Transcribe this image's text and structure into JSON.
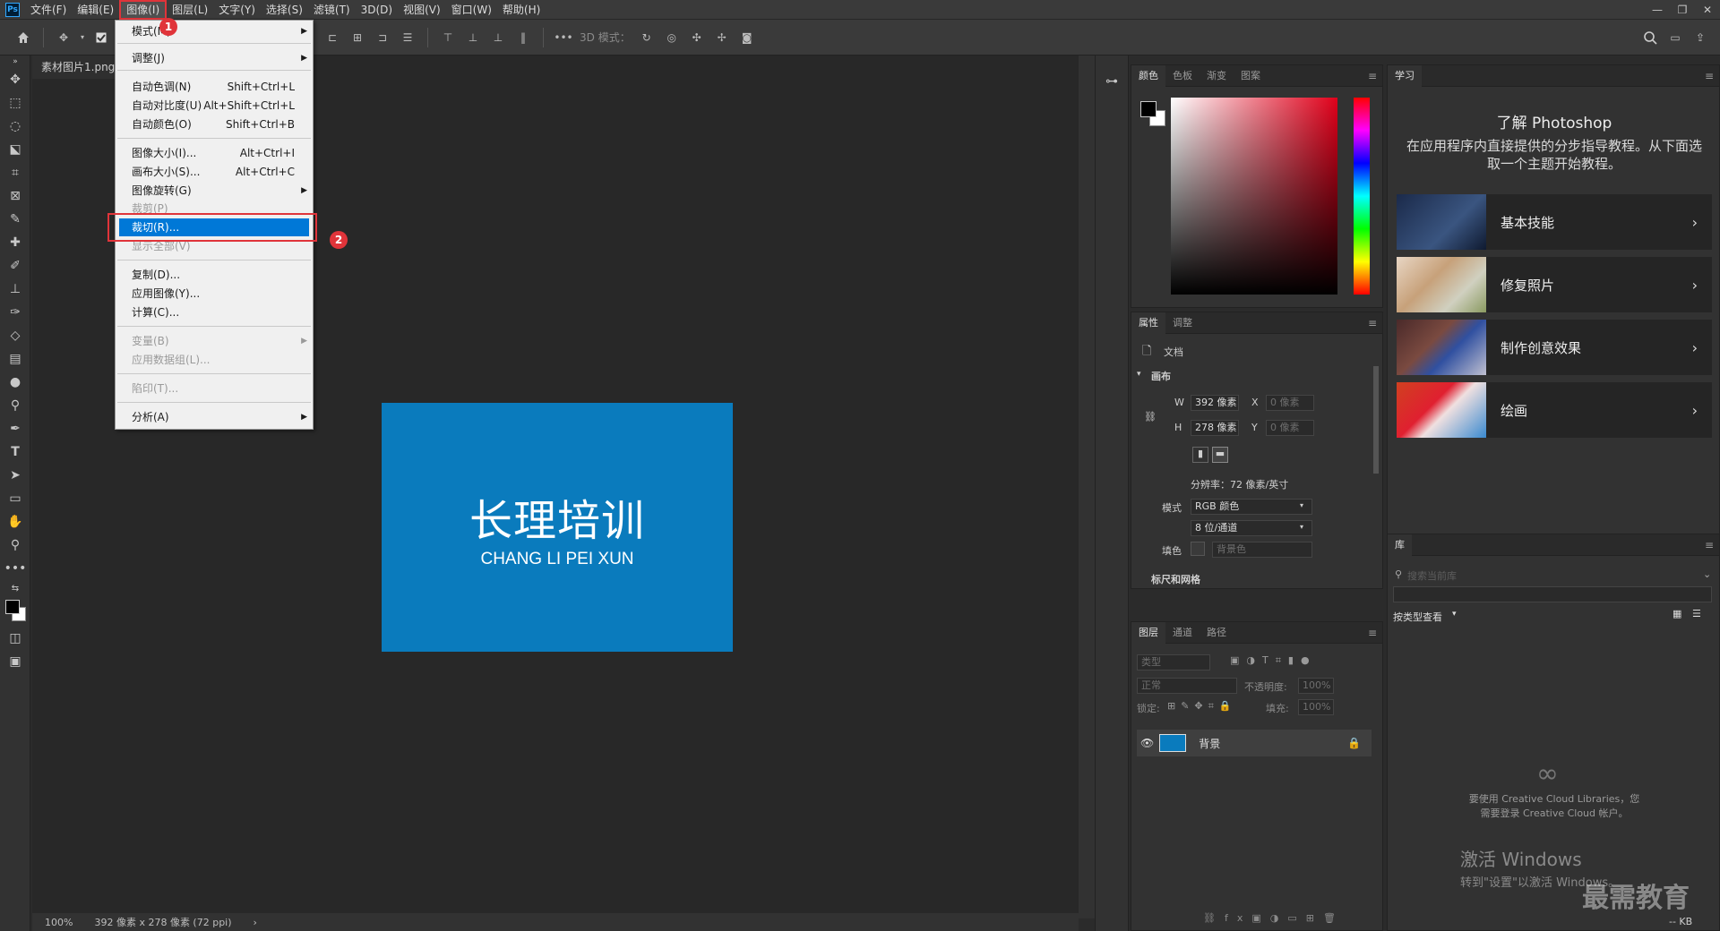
{
  "app": {
    "logo": "Ps"
  },
  "menubar": {
    "items": [
      "文件(F)",
      "编辑(E)",
      "图像(I)",
      "图层(L)",
      "文字(Y)",
      "选择(S)",
      "滤镜(T)",
      "3D(D)",
      "视图(V)",
      "窗口(W)",
      "帮助(H)"
    ],
    "active_index": 2
  },
  "options": {
    "mode_3d_label": "3D 模式："
  },
  "document": {
    "tab_title": "素材图片1.png",
    "image_title": "长理培训",
    "image_subtitle": "CHANG LI PEI XUN",
    "image_color": "#0a7bbd"
  },
  "status": {
    "zoom": "100%",
    "info": "392 像素 x 278 像素 (72 ppi)",
    "arrow": "›"
  },
  "image_menu": {
    "items": [
      {
        "label": "模式(M)",
        "submenu": true
      },
      {
        "label": "调整(J)",
        "submenu": true
      },
      {
        "label": "自动色调(N)",
        "shortcut": "Shift+Ctrl+L"
      },
      {
        "label": "自动对比度(U)",
        "shortcut": "Alt+Shift+Ctrl+L"
      },
      {
        "label": "自动颜色(O)",
        "shortcut": "Shift+Ctrl+B"
      },
      {
        "label": "图像大小(I)...",
        "shortcut": "Alt+Ctrl+I"
      },
      {
        "label": "画布大小(S)...",
        "shortcut": "Alt+Ctrl+C"
      },
      {
        "label": "图像旋转(G)",
        "submenu": true
      },
      {
        "label": "裁剪(P)",
        "disabled": true
      },
      {
        "label": "裁切(R)...",
        "highlighted": true
      },
      {
        "label": "显示全部(V)",
        "disabled": true
      },
      {
        "label": "复制(D)..."
      },
      {
        "label": "应用图像(Y)..."
      },
      {
        "label": "计算(C)..."
      },
      {
        "label": "变量(B)",
        "disabled": true,
        "submenu": true
      },
      {
        "label": "应用数据组(L)...",
        "disabled": true
      },
      {
        "label": "陷印(T)...",
        "disabled": true
      },
      {
        "label": "分析(A)",
        "submenu": true
      }
    ],
    "badges": [
      "1",
      "2"
    ]
  },
  "color_panel": {
    "tabs": [
      "颜色",
      "色板",
      "渐变",
      "图案"
    ]
  },
  "properties_panel": {
    "tabs": [
      "属性",
      "调整"
    ],
    "doc_label": "文档",
    "section": "画布",
    "w_label": "W",
    "w_value": "392 像素",
    "h_label": "H",
    "h_value": "278 像素",
    "x_label": "X",
    "x_value": "0 像素",
    "y_label": "Y",
    "y_value": "0 像素",
    "resolution": "分辨率：72 像素/英寸",
    "mode_label": "模式",
    "mode_value": "RGB 颜色",
    "depth_value": "8 位/通道",
    "fill_label": "填色",
    "fill_value": "背景色",
    "next_section": "标尺和网格"
  },
  "layers_panel": {
    "tabs": [
      "图层",
      "通道",
      "路径"
    ],
    "filter_placeholder": "类型",
    "blend_mode": "正常",
    "opacity_label": "不透明度:",
    "opacity_value": "100%",
    "lock_label": "锁定:",
    "fill_label": "填充:",
    "fill_value": "100%",
    "layer_name": "背景"
  },
  "learn_panel": {
    "tab": "学习",
    "title": "了解 Photoshop",
    "desc": "在应用程序内直接提供的分步指导教程。从下面选取一个主题开始教程。",
    "cards": [
      "基本技能",
      "修复照片",
      "制作创意效果",
      "绘画"
    ]
  },
  "library_panel": {
    "tab": "库",
    "search_placeholder": "搜索当前库",
    "view_label": "按类型查看",
    "message_line1": "要使用 Creative Cloud Libraries，您",
    "message_line2": "需要登录 Creative Cloud 帐户。",
    "size_label": "-- KB"
  },
  "overlay": {
    "activate_line1": "激活 Windows",
    "activate_line2": "转到\"设置\"以激活 Windows。",
    "watermark": "最需教育"
  }
}
